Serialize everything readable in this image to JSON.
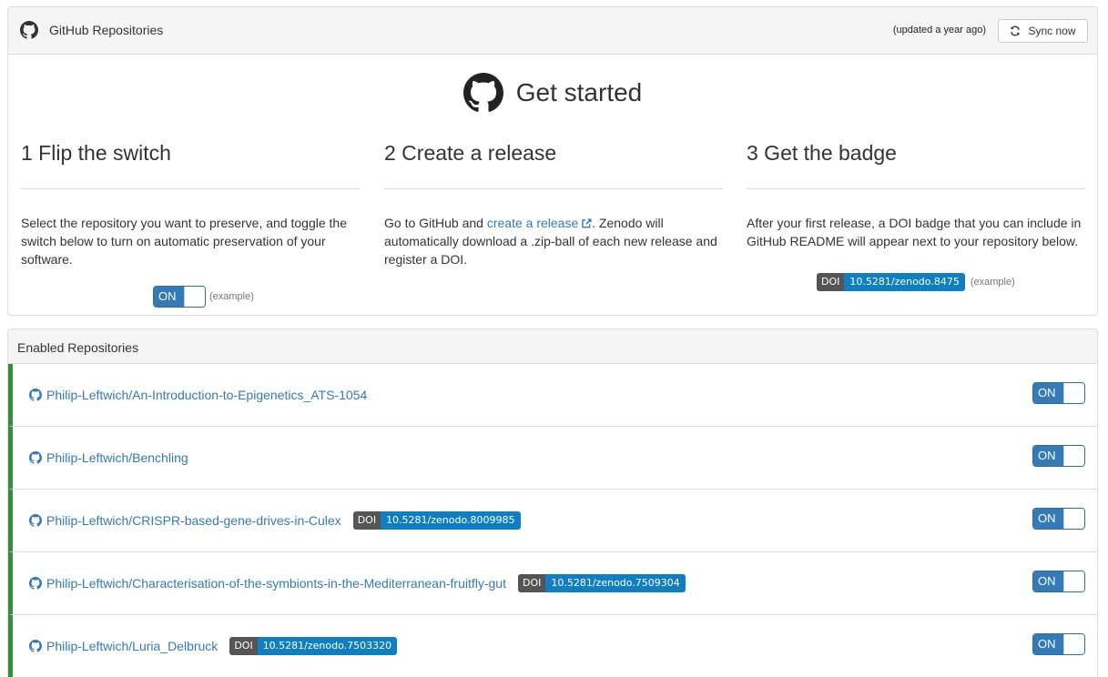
{
  "header": {
    "title": "GitHub Repositories",
    "updated": "(updated a year ago)",
    "sync_label": "Sync now"
  },
  "hero": {
    "title": "Get started"
  },
  "steps": [
    {
      "title": "1 Flip the switch",
      "text": "Select the repository you want to preserve, and toggle the switch below to turn on automatic preservation of your software.",
      "toggle_label": "ON",
      "example": "(example)"
    },
    {
      "title": "2 Create a release",
      "text_before": "Go to GitHub and ",
      "link_text": "create a release",
      "text_after": ". Zenodo will automatically download a .zip-ball of each new release and register a DOI."
    },
    {
      "title": "3 Get the badge",
      "text": "After your first release, a DOI badge that you can include in GitHub README will appear next to your repository below.",
      "badge_key": "DOI",
      "badge_value": "10.5281/zenodo.8475",
      "example": "(example)"
    }
  ],
  "enabled": {
    "title": "Enabled Repositories",
    "repos": [
      {
        "name": "Philip-Leftwich/An-Introduction-to-Epigenetics_ATS-1054",
        "doi": "",
        "toggle": "ON"
      },
      {
        "name": "Philip-Leftwich/Benchling",
        "doi": "",
        "toggle": "ON"
      },
      {
        "name": "Philip-Leftwich/CRISPR-based-gene-drives-in-Culex",
        "doi_key": "DOI",
        "doi": "10.5281/zenodo.8009985",
        "toggle": "ON"
      },
      {
        "name": "Philip-Leftwich/Characterisation-of-the-symbionts-in-the-Mediterranean-fruitfly-gut",
        "doi_key": "DOI",
        "doi": "10.5281/zenodo.7509304",
        "toggle": "ON"
      },
      {
        "name": "Philip-Leftwich/Luria_Delbruck",
        "doi_key": "DOI",
        "doi": "10.5281/zenodo.7503320",
        "toggle": "ON"
      }
    ]
  },
  "colors": {
    "accent": "#337ab7",
    "enabled_bar": "#3c8b3c",
    "doi_key_bg": "#555555",
    "doi_value_bg": "#0f7fc1"
  },
  "icons": [
    "github-icon",
    "sync-icon",
    "external-link-icon"
  ]
}
